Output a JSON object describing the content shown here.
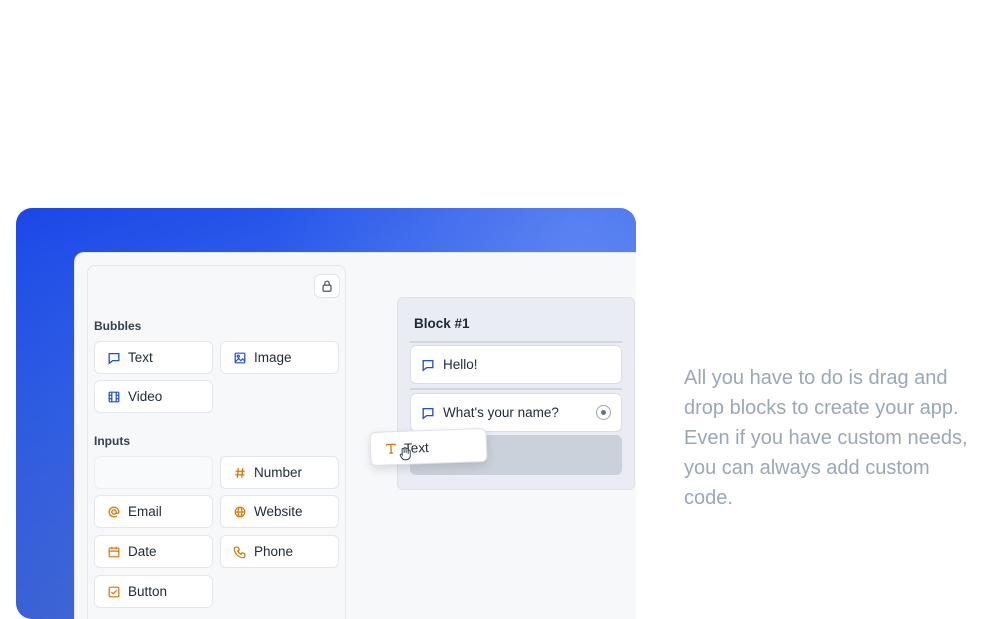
{
  "colors": {
    "bubble_icon": "#1d4ed8",
    "input_icon": "#d97706",
    "description_text": "#9ba7b8",
    "card_gradient_start": "#1b47e6",
    "card_gradient_end": "#6d95f6"
  },
  "sidebar": {
    "lock_icon": "lock-icon",
    "bubbles": {
      "title": "Bubbles",
      "items": [
        {
          "label": "Text",
          "icon": "chat-bubble-icon"
        },
        {
          "label": "Image",
          "icon": "image-icon"
        },
        {
          "label": "Video",
          "icon": "film-icon"
        }
      ]
    },
    "inputs": {
      "title": "Inputs",
      "items": [
        {
          "label": "",
          "icon": ""
        },
        {
          "label": "Number",
          "icon": "hash-icon"
        },
        {
          "label": "Email",
          "icon": "at-icon"
        },
        {
          "label": "Website",
          "icon": "globe-icon"
        },
        {
          "label": "Date",
          "icon": "calendar-icon"
        },
        {
          "label": "Phone",
          "icon": "phone-icon"
        },
        {
          "label": "Button",
          "icon": "checkbox-icon"
        }
      ]
    }
  },
  "canvas": {
    "group": {
      "title": "Block #1",
      "steps": [
        {
          "label": "Hello!",
          "icon": "chat-bubble-icon"
        },
        {
          "label": "What's your name?",
          "icon": "chat-bubble-icon"
        }
      ]
    },
    "drag_ghost": {
      "label": "Text",
      "icon": "text-t-icon"
    }
  },
  "description": "All you have to do is drag and drop blocks to create your app. Even if you have custom needs, you can always add custom code."
}
